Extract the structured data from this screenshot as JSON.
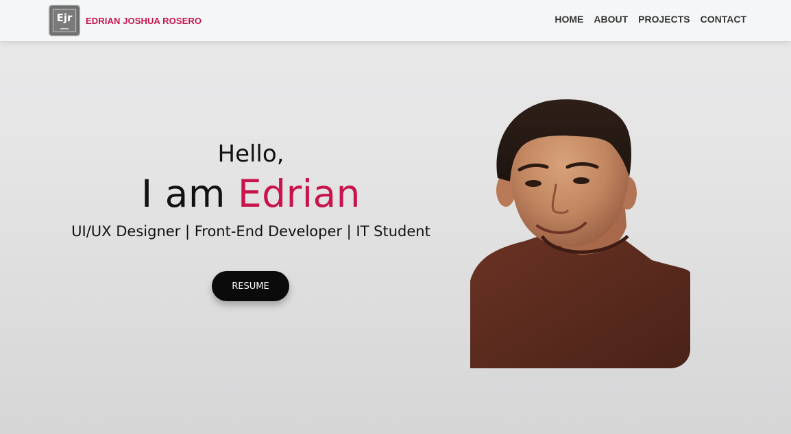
{
  "header": {
    "logo_text": "Ejr",
    "brand_name": "EDRIAN JOSHUA ROSERO",
    "nav": [
      "HOME",
      "ABOUT",
      "PROJECTS",
      "CONTACT"
    ]
  },
  "hero": {
    "greeting": "Hello,",
    "headline_prefix": "I am",
    "headline_name": "Edrian",
    "roles": "UI/UX Designer | Front-End Developer | IT Student",
    "resume_label": "RESUME"
  },
  "colors": {
    "accent": "#c8144b",
    "text": "#111111",
    "button_bg": "#0b0b0b"
  },
  "icons": {
    "portrait": "person-photo"
  }
}
